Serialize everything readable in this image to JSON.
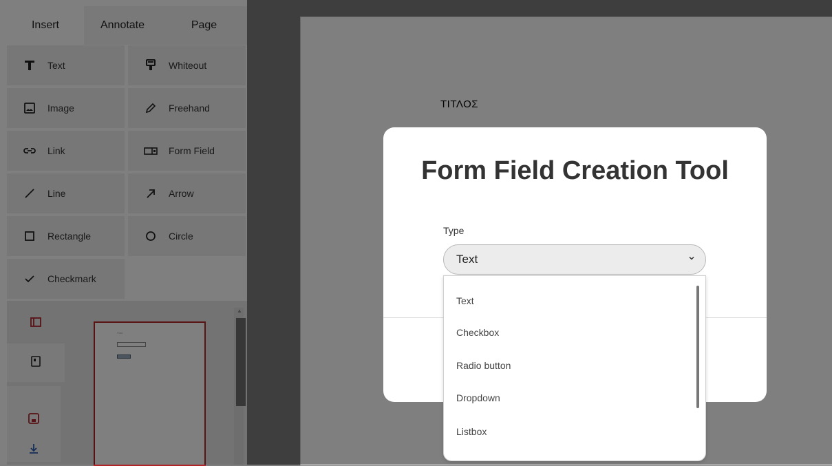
{
  "tabs": [
    {
      "label": "Insert",
      "active": true
    },
    {
      "label": "Annotate",
      "active": false
    },
    {
      "label": "Page",
      "active": false
    }
  ],
  "tools": [
    {
      "label": "Text",
      "icon": "text-T-icon"
    },
    {
      "label": "Whiteout",
      "icon": "whiteout-brush-icon"
    },
    {
      "label": "Image",
      "icon": "image-icon"
    },
    {
      "label": "Freehand",
      "icon": "pencil-icon"
    },
    {
      "label": "Link",
      "icon": "link-icon"
    },
    {
      "label": "Form Field",
      "icon": "form-field-icon"
    },
    {
      "label": "Line",
      "icon": "line-icon"
    },
    {
      "label": "Arrow",
      "icon": "arrow-icon"
    },
    {
      "label": "Rectangle",
      "icon": "rectangle-icon"
    },
    {
      "label": "Circle",
      "icon": "circle-icon"
    },
    {
      "label": "Checkmark",
      "icon": "checkmark-icon"
    }
  ],
  "document": {
    "title": "ΤΙΤΛΟΣ"
  },
  "modal": {
    "title": "Form Field Creation Tool",
    "type_label": "Type",
    "selected_type": "Text",
    "options": [
      "Text",
      "Checkbox",
      "Radio button",
      "Dropdown",
      "Listbox"
    ]
  },
  "thumbnail": {
    "caption": "Vnst"
  },
  "colors": {
    "accent": "#b0262b",
    "overlay": "rgba(0,0,0,0.5)"
  }
}
